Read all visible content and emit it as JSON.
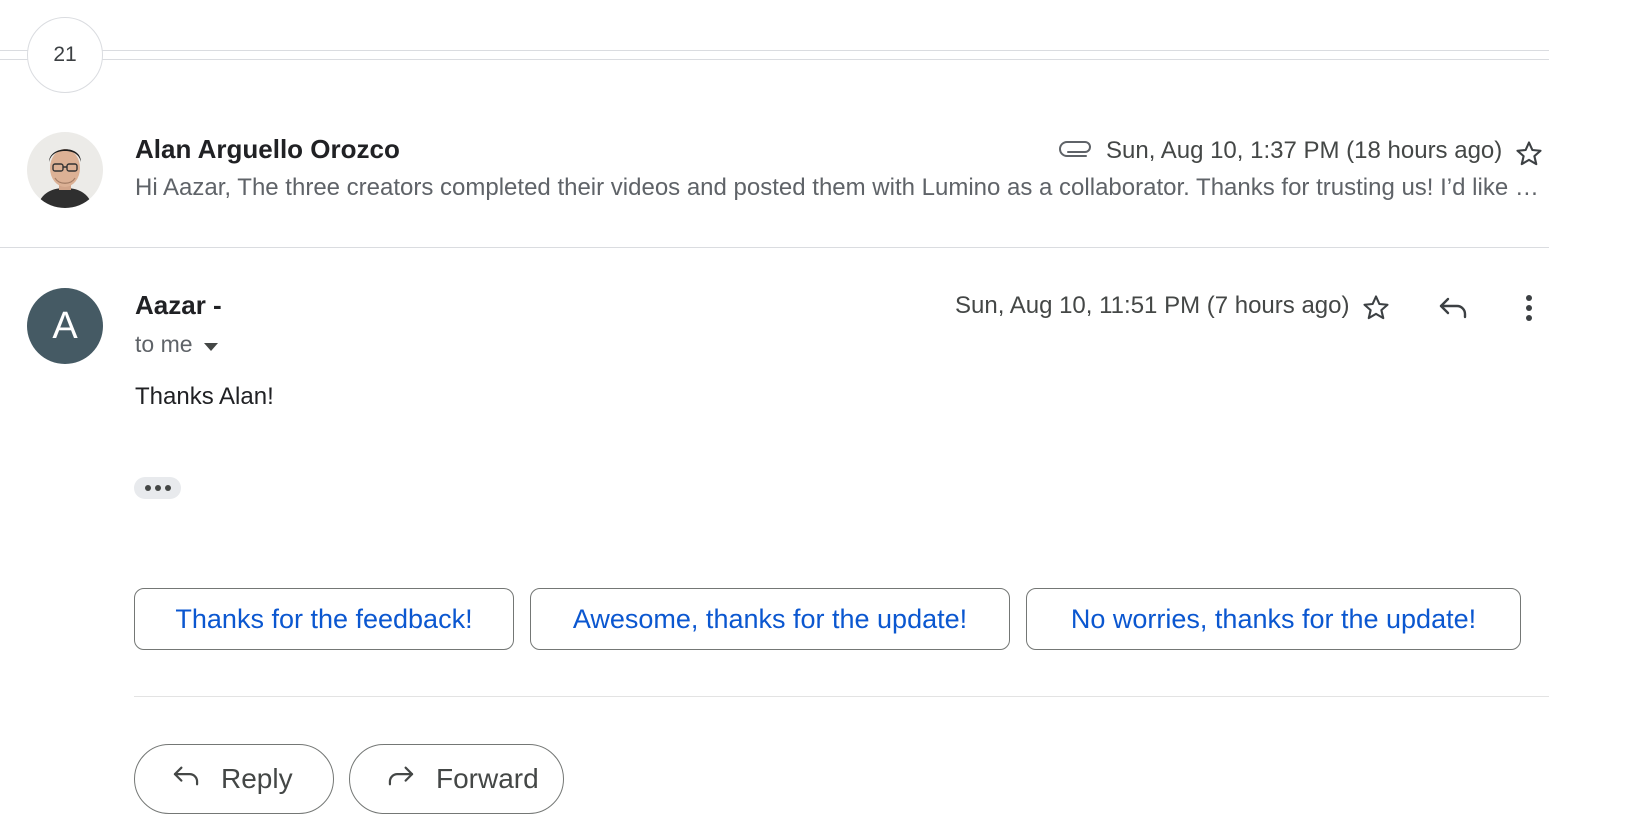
{
  "thread": {
    "collapsed_count": "21"
  },
  "message1": {
    "sender": "Alan Arguello Orozco",
    "date": "Sun, Aug 10, 1:37 PM (18 hours ago)",
    "snippet": "Hi Aazar, The three creators completed their videos and posted them with Lumino as a collaborator. Thanks for trusting us! I’d like to share"
  },
  "message2": {
    "avatar_letter": "A",
    "avatar_color": "#455a64",
    "sender": "Aazar -",
    "date": "Sun, Aug 10, 11:51 PM (7 hours ago)",
    "to_label": "to me",
    "body": "Thanks Alan!"
  },
  "smart_replies": [
    "Thanks for the feedback!",
    "Awesome, thanks for the update!",
    "No worries, thanks for the update!"
  ],
  "actions": {
    "reply": "Reply",
    "forward": "Forward"
  },
  "colors": {
    "link": "#0b57d0",
    "divider": "#dadce0"
  }
}
